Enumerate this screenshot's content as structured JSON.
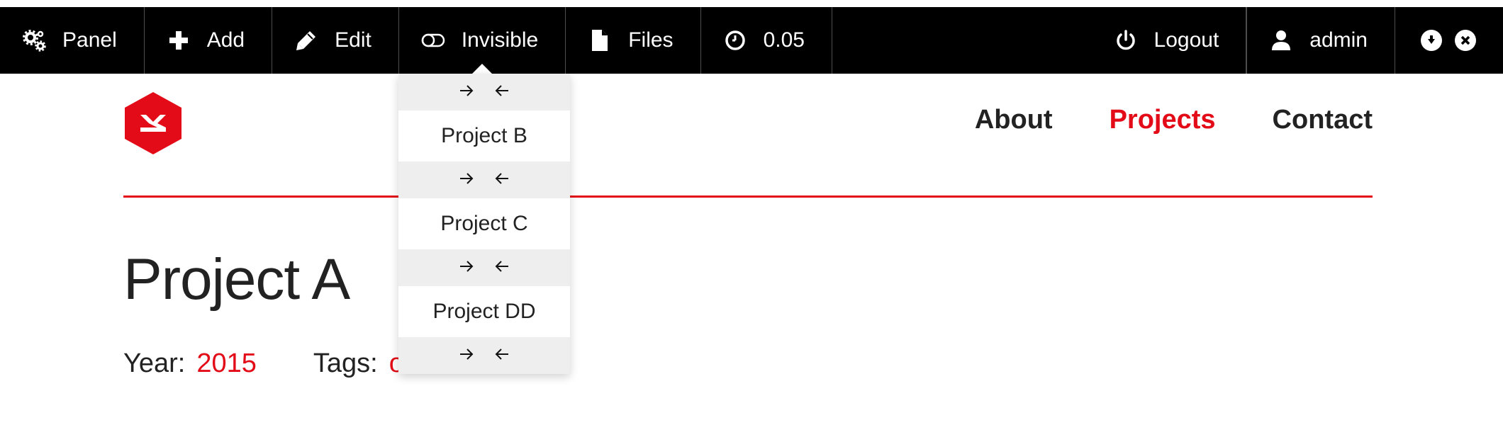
{
  "toolbar": {
    "panel": {
      "label": "Panel",
      "icon": "gears-icon"
    },
    "add": {
      "label": "Add",
      "icon": "plus-icon"
    },
    "edit": {
      "label": "Edit",
      "icon": "pencil-icon"
    },
    "invisible": {
      "label": "Invisible",
      "icon": "toggle-icon"
    },
    "files": {
      "label": "Files",
      "icon": "file-icon"
    },
    "time": {
      "label": "0.05",
      "icon": "clock-icon"
    },
    "logout": {
      "label": "Logout",
      "icon": "power-icon"
    },
    "user": {
      "label": "admin",
      "icon": "user-icon"
    },
    "extra_icons": [
      "download-circle-icon",
      "close-circle-icon"
    ]
  },
  "site": {
    "logo_icon": "kirby-hexagon-logo",
    "nav": [
      {
        "label": "About",
        "active": false
      },
      {
        "label": "Projects",
        "active": true
      },
      {
        "label": "Contact",
        "active": false
      }
    ]
  },
  "page": {
    "title": "Project A",
    "year_label": "Year:",
    "year_value": "2015",
    "tags_label": "Tags:",
    "tags_value": "o"
  },
  "dropdown": {
    "items": [
      "Project B",
      "Project C",
      "Project DD"
    ],
    "arrow_icons": [
      "arrow-right-icon",
      "arrow-left-icon"
    ]
  },
  "colors": {
    "accent": "#e30b17",
    "toolbar_bg": "#000000",
    "dropdown_row_bg": "#eeeeee"
  }
}
